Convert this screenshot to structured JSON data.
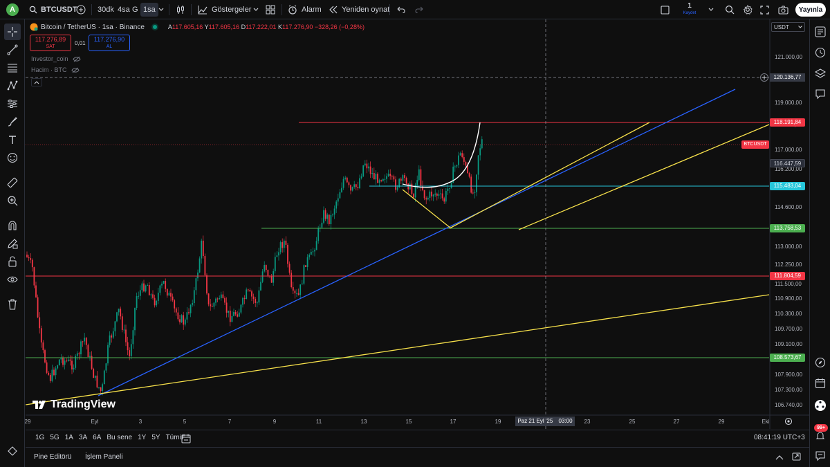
{
  "topbar": {
    "avatar_letter": "A",
    "symbol": "BTCUSDT",
    "intervals": [
      "30dk",
      "4sa",
      "G",
      "1sa"
    ],
    "indicators_label": "Göstergeler",
    "alarm_label": "Alarm",
    "replay_label": "Yeniden oynat",
    "save_count": "1",
    "save_label": "Kaydet",
    "publish_label": "Yayınla"
  },
  "legend": {
    "title": "Bitcoin / TetherUS · 1sa · Binance",
    "open_label": "A",
    "open_value": "117.605,16",
    "high_label": "Y",
    "high_value": "117.605,16",
    "low_label": "D",
    "low_value": "117.222,01",
    "close_label": "K",
    "close_value": "117.276,90",
    "change": "−328,26 (−0,28%)",
    "sell_price": "117.276,89",
    "sell_label": "SAT",
    "spread": "0,01",
    "buy_price": "117.276,90",
    "buy_label": "AL",
    "indicator1": "Investor_coin",
    "indicator2": "Hacim · BTC"
  },
  "axis": {
    "currency": "USDT",
    "cursor_price": "120.136,77",
    "last_price_symbol": "BTCUSDT",
    "price_ticks": [
      "121.000,00",
      "119.000,00",
      "118.000,00",
      "117.000,00",
      "116.200,00",
      "114.600,00",
      "113.000,00",
      "112.250,00",
      "111.500,00",
      "110.900,00",
      "110.300,00",
      "109.700,00",
      "109.100,00",
      "107.900,00",
      "107.300,00",
      "106.740,00"
    ],
    "date_ticks": [
      "29",
      "Eyl",
      "3",
      "5",
      "7",
      "9",
      "11",
      "13",
      "15",
      "17",
      "19",
      "23",
      "25",
      "27",
      "29",
      "Eki"
    ],
    "cursor_date": "Paz 21 Eyl '25",
    "cursor_time": "03:00"
  },
  "price_labels": [
    {
      "text": "118.191,84",
      "color": "#f23645"
    },
    {
      "text": "116.447,59",
      "color": "#2a2e39"
    },
    {
      "text": "115.483,04",
      "color": "#26c6da"
    },
    {
      "text": "113.758,53",
      "color": "#4caf50"
    },
    {
      "text": "111.804,59",
      "color": "#f23645"
    },
    {
      "text": "108.573,67",
      "color": "#4caf50"
    }
  ],
  "colors": {
    "up": "#089981",
    "down": "#f23645",
    "trend_blue": "#2962ff",
    "trend_yellow": "#f7e14b",
    "level_green": "#4caf50",
    "level_cyan": "#26c6da"
  },
  "watermark": "TradingView",
  "range": {
    "buttons": [
      "1G",
      "5G",
      "1A",
      "3A",
      "6A",
      "Bu sene",
      "1Y",
      "5Y",
      "Tümü"
    ],
    "clock": "08:41:19 UTC+3"
  },
  "bottom": {
    "tab1": "Pine Editörü",
    "tab2": "İşlem Paneli"
  },
  "notifications": "99+"
}
